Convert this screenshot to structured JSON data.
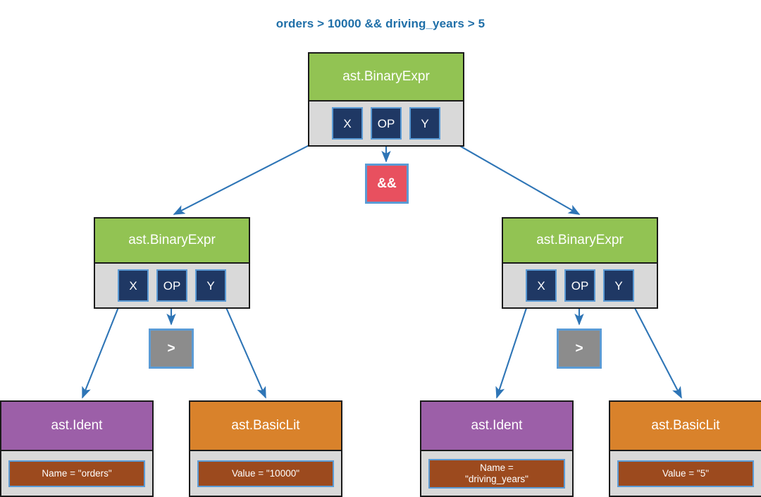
{
  "title": "orders > 10000 && driving_years > 5",
  "colors": {
    "title_text": "#1F6FA8",
    "binary_expr_header": "#92C353",
    "ident_header": "#9C5FA8",
    "basiclit_header": "#D9822B",
    "node_body": "#D9D9D9",
    "field_chip": "#1F3864",
    "field_chip_border": "#5B9BD5",
    "attr_chip": "#9C4A1E",
    "op_and": "#E8505F",
    "op_gt": "#8C8C8C",
    "arrow": "#2E75B6",
    "background": "#FFFFFF"
  },
  "nodes": {
    "root": {
      "type": "ast.BinaryExpr",
      "fields": [
        "X",
        "OP",
        "Y"
      ]
    },
    "left_expr": {
      "type": "ast.BinaryExpr",
      "fields": [
        "X",
        "OP",
        "Y"
      ]
    },
    "right_expr": {
      "type": "ast.BinaryExpr",
      "fields": [
        "X",
        "OP",
        "Y"
      ]
    },
    "root_op": {
      "token": "&&"
    },
    "left_op": {
      "token": ">"
    },
    "right_op": {
      "token": ">"
    },
    "left_ident": {
      "type": "ast.Ident",
      "attribute": "Name = \"orders\""
    },
    "left_literal": {
      "type": "ast.BasicLit",
      "attribute": "Value = \"10000\""
    },
    "right_ident": {
      "type": "ast.Ident",
      "attribute": "Name =\n\"driving_years\""
    },
    "right_literal": {
      "type": "ast.BasicLit",
      "attribute": "Value = \"5\""
    }
  }
}
